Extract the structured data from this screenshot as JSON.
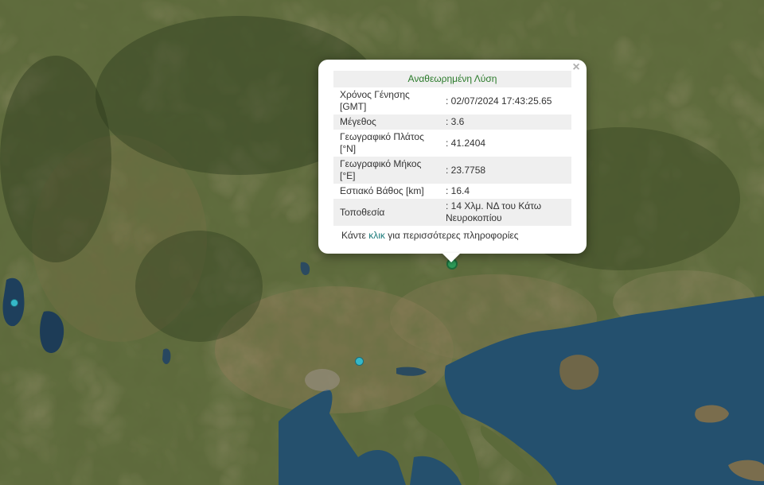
{
  "popup": {
    "title": "Αναθεωρημένη Λύση",
    "close_glyph": "×",
    "rows": [
      {
        "key": "Χρόνος Γένησης [GMT]",
        "value": ": 02/07/2024 17:43:25.65"
      },
      {
        "key": "Μέγεθος",
        "value": ": 3.6"
      },
      {
        "key": "Γεωγραφικό Πλάτος [°N]",
        "value": ": 41.2404"
      },
      {
        "key": "Γεωγραφικό Μήκος [°E]",
        "value": ": 23.7758"
      },
      {
        "key": "Εστιακό Βάθος [km]",
        "value": ": 16.4"
      },
      {
        "key": "Τοποθεσία",
        "value": ": 14 Χλμ. ΝΔ του Κάτω Νευροκοπίου"
      }
    ],
    "footer": {
      "before": "Κάντε ",
      "link": "κλικ",
      "after": " για περισσότερες πληροφορίες"
    }
  },
  "markers": {
    "selected": {
      "color": "#2e9c5a",
      "icon": "earthquake-marker-selected"
    },
    "other": {
      "color": "#35b8c8",
      "icon": "earthquake-marker"
    }
  }
}
